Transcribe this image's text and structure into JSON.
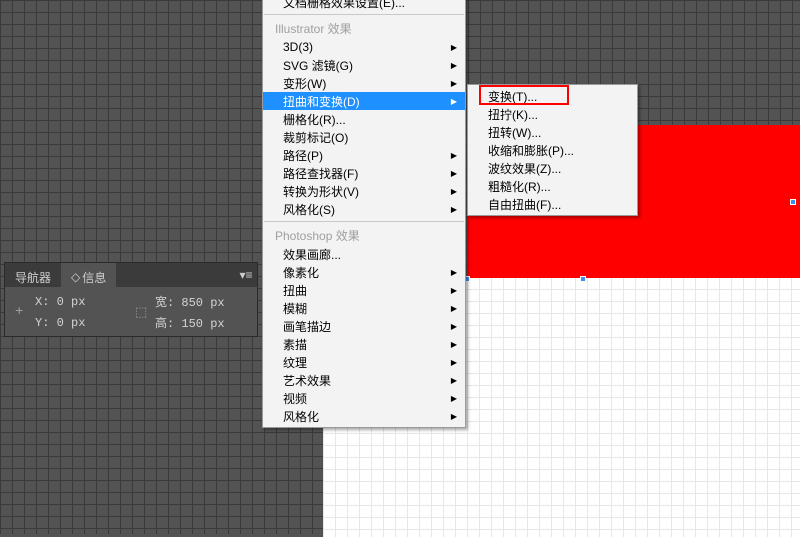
{
  "info_panel": {
    "tab_nav": "导航器",
    "tab_info": "信息",
    "x_label": "X:",
    "y_label": "Y:",
    "x_value": "0 px",
    "y_value": "0 px",
    "w_label": "宽:",
    "h_label": "高:",
    "w_value": "850 px",
    "h_value": "150 px"
  },
  "menu1": {
    "top_item": "文档栅格效果设置(E)...",
    "header1": "Illustrator 效果",
    "items1": [
      {
        "label": "3D(3)",
        "sub": true
      },
      {
        "label": "SVG 滤镜(G)",
        "sub": true
      },
      {
        "label": "变形(W)",
        "sub": true
      },
      {
        "label": "扭曲和变换(D)",
        "sub": true,
        "hl": true
      },
      {
        "label": "栅格化(R)...",
        "sub": false
      },
      {
        "label": "裁剪标记(O)",
        "sub": false
      },
      {
        "label": "路径(P)",
        "sub": true
      },
      {
        "label": "路径查找器(F)",
        "sub": true
      },
      {
        "label": "转换为形状(V)",
        "sub": true
      },
      {
        "label": "风格化(S)",
        "sub": true
      }
    ],
    "header2": "Photoshop 效果",
    "items2": [
      {
        "label": "效果画廊...",
        "sub": false
      },
      {
        "label": "像素化",
        "sub": true
      },
      {
        "label": "扭曲",
        "sub": true
      },
      {
        "label": "模糊",
        "sub": true
      },
      {
        "label": "画笔描边",
        "sub": true
      },
      {
        "label": "素描",
        "sub": true
      },
      {
        "label": "纹理",
        "sub": true
      },
      {
        "label": "艺术效果",
        "sub": true
      },
      {
        "label": "视频",
        "sub": true
      },
      {
        "label": "风格化",
        "sub": true
      }
    ]
  },
  "menu2": {
    "items": [
      {
        "label": "变换(T)...",
        "box": true
      },
      {
        "label": "扭拧(K)..."
      },
      {
        "label": "扭转(W)..."
      },
      {
        "label": "收缩和膨胀(P)..."
      },
      {
        "label": "波纹效果(Z)..."
      },
      {
        "label": "粗糙化(R)..."
      },
      {
        "label": "自由扭曲(F)..."
      }
    ]
  }
}
